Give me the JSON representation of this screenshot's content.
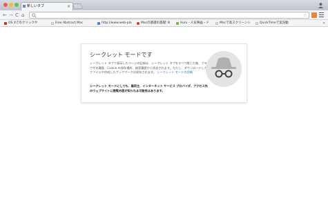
{
  "window": {
    "tab_title": "新しいタブ",
    "tab_close": "×"
  },
  "toolbar": {
    "back": "←",
    "forward": "→",
    "reload": "C",
    "home": "⌂",
    "omnibox_value": "",
    "star": "☆"
  },
  "bookmarks": {
    "items": [
      {
        "label": "OS Xでのクリックや",
        "color": "#b5362f"
      },
      {
        "label": "Free Abstract Mac ",
        "color": "#e6e6e6"
      },
      {
        "label": "http://www.web-pla",
        "color": "#4f7ad6"
      },
      {
        "label": "Macの基礎の基礎: B",
        "color": "#c0392b"
      },
      {
        "label": "Hulu - 人気映画・ド",
        "color": "#7db33a"
      },
      {
        "label": "Macで高スクリーンシ",
        "color": "#e6e6e6"
      },
      {
        "label": "QuickTimeで実況動",
        "color": "#e6e6e6"
      }
    ],
    "more": "»"
  },
  "incognito": {
    "title": "シークレット モードです",
    "body": "シークレット タブで表示したページの記録は、シークレット タブをすべて閉じた後、ブラウザの履歴、Cookie の保存場所、検索履歴から消去されます。ただし、ダウンロードしたファイルや作成したブックマークは保存されます。",
    "learn_more": "シークレット モードの詳細",
    "warning": "シークレット モードにしても、雇用主、インターネット サービス プロバイダ、アクセス先のウェブサイトに閲覧内容が知られる可能性はあります。"
  }
}
